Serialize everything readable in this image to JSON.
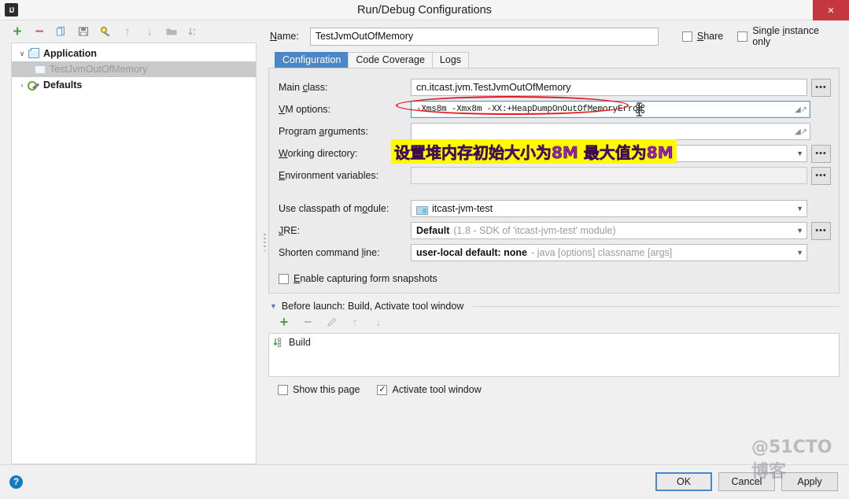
{
  "window": {
    "title": "Run/Debug Configurations",
    "app_icon": "intellij-idea-icon",
    "close_label": "×"
  },
  "left_panel": {
    "toolbar": [
      {
        "name": "add-configuration-button",
        "glyph": "+",
        "color": "#4f9e4f"
      },
      {
        "name": "remove-configuration-button",
        "glyph": "−",
        "color": "#c45a6a"
      },
      {
        "name": "copy-configuration-button",
        "glyph": "❐",
        "color": "#6f9ec4"
      },
      {
        "name": "save-configuration-button",
        "glyph": "Ὃe",
        "color": "#6e6e6e"
      },
      {
        "name": "edit-templates-button",
        "glyph": "⚙",
        "color": "#7a9c3f"
      },
      {
        "name": "move-up-button",
        "glyph": "↑",
        "color": "#b0b0b0"
      },
      {
        "name": "move-down-button",
        "glyph": "↓",
        "color": "#b0b0b0"
      },
      {
        "name": "move-into-folder-button",
        "glyph": "▰",
        "color": "#b0b0b0"
      },
      {
        "name": "sort-configurations-button",
        "glyph": "⇩",
        "color": "#b0b0b0"
      }
    ],
    "tree": [
      {
        "label": "Application",
        "twisty": "∨",
        "icon": "application-icon",
        "bold": true,
        "indent": 0,
        "selected": false
      },
      {
        "label": "TestJvmOutOfMemory",
        "twisty": "",
        "icon": "configuration-icon",
        "bold": false,
        "indent": 1,
        "selected": true
      },
      {
        "label": "Defaults",
        "twisty": "›",
        "icon": "defaults-wrench-icon",
        "bold": true,
        "indent": 0,
        "selected": false
      }
    ]
  },
  "header": {
    "name_label": "Name:",
    "name_value": "TestJvmOutOfMemory",
    "share_label": "Share",
    "share_checked": false,
    "single_instance_label": "Single instance only",
    "single_instance_checked": false
  },
  "tabs": [
    {
      "label": "Configuration",
      "active": true
    },
    {
      "label": "Code Coverage",
      "active": false
    },
    {
      "label": "Logs",
      "active": false
    }
  ],
  "form": {
    "main_class_label": "Main class:",
    "main_class_value": "cn.itcast.jvm.TestJvmOutOfMemory",
    "vm_options_label": "VM options:",
    "vm_options_value": "-Xms8m  -Xmx8m  -XX:+HeapDumpOnOutOfMemoryError",
    "program_arguments_label": "Program arguments:",
    "program_arguments_value": "",
    "working_directory_label": "Working directory:",
    "working_directory_value": "",
    "environment_variables_label": "Environment variables:",
    "environment_variables_value": "",
    "use_classpath_label": "Use classpath of module:",
    "use_classpath_value": "itcast-jvm-test",
    "jre_label": "JRE:",
    "jre_value_bold": "Default",
    "jre_value_dim": "(1.8 - SDK of 'itcast-jvm-test' module)",
    "shorten_label": "Shorten command line:",
    "shorten_value_bold": "user-local default: none",
    "shorten_value_dim": "- java [options] classname [args]",
    "enable_snapshots_label": "Enable capturing form snapshots",
    "enable_snapshots_checked": false,
    "browse_button_label": "•••"
  },
  "before_launch": {
    "title": "Before launch: Build, Activate tool window",
    "toolbar": [
      {
        "name": "add-task-button",
        "glyph": "+",
        "color": "#4f9e4f"
      },
      {
        "name": "remove-task-button",
        "glyph": "−",
        "color": "#b4b4b4"
      },
      {
        "name": "edit-task-button",
        "glyph": "✐",
        "color": "#b4b4b4"
      },
      {
        "name": "task-move-up-button",
        "glyph": "↑",
        "color": "#b4b4b4"
      },
      {
        "name": "task-move-down-button",
        "glyph": "↓",
        "color": "#b4b4b4"
      }
    ],
    "items": [
      {
        "label": "Build",
        "icon": "build-icon"
      }
    ],
    "show_page_label": "Show this page",
    "show_page_checked": false,
    "activate_window_label": "Activate tool window",
    "activate_window_checked": true
  },
  "footer": {
    "help_label": "?",
    "ok_label": "OK",
    "cancel_label": "Cancel",
    "apply_label": "Apply"
  },
  "annotations": {
    "chinese_note": "设置堆内存初始大小为8M  最大值为8M",
    "watermark": "@51CTO博客",
    "highlight_color": "#fffa00",
    "note_text_color": "#9b1fc1",
    "ellipse_color": "#e8141e"
  }
}
